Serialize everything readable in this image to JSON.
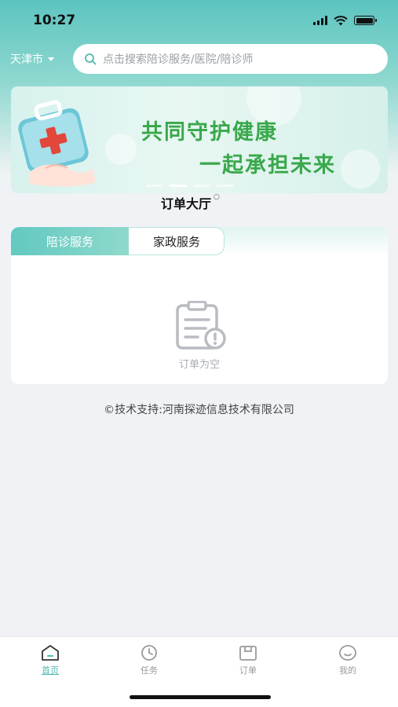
{
  "status_bar": {
    "time": "10:27"
  },
  "header": {
    "city": "天津市",
    "search_placeholder": "点击搜索陪诊服务/医院/陪诊师"
  },
  "banner": {
    "line1": "共同守护健康",
    "line2": "一起承担未来"
  },
  "hall": {
    "title": "订单大厅"
  },
  "order_tabs": [
    {
      "label": "陪诊服务",
      "active": true
    },
    {
      "label": "家政服务",
      "active": false
    }
  ],
  "empty_state": {
    "text": "订单为空"
  },
  "footer": {
    "copyright": "©技术支持:河南探迹信息技术有限公司"
  },
  "tabbar": [
    {
      "label": "首页",
      "icon": "home-icon",
      "active": true
    },
    {
      "label": "任务",
      "icon": "clock-icon",
      "active": false
    },
    {
      "label": "订单",
      "icon": "box-icon",
      "active": false
    },
    {
      "label": "我的",
      "icon": "smile-icon",
      "active": false
    }
  ],
  "colors": {
    "accent": "#4fb8b0",
    "banner_text": "#39a84b"
  }
}
